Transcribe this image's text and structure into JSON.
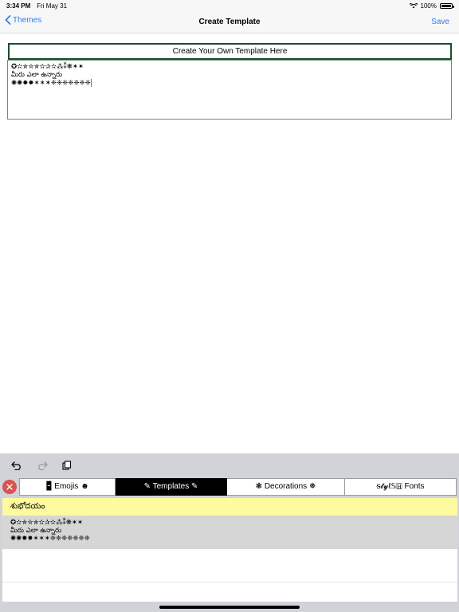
{
  "status": {
    "time": "3:34 PM",
    "date": "Fri May 31",
    "battery": "100%",
    "battery_level": 1.0
  },
  "nav": {
    "back_label": "Themes",
    "title": "Create Template",
    "save_label": "Save"
  },
  "editor": {
    "header": "Create Your Own Template Here",
    "lines": [
      "✪✫✯✮✯✫✰✫⁂⁑❋✶✶",
      "మీరు ఎలా ఉన్నారు",
      "✺✺✹✸✶✶✶❈❈❈❈❈❈❈"
    ]
  },
  "toolbar": {
    "icons": [
      "undo-icon",
      "redo-icon",
      "paste-icon"
    ]
  },
  "tabs": [
    {
      "label": "🁢 Emojis ☻",
      "active": false
    },
    {
      "label": "✎ Templates ✎",
      "active": true
    },
    {
      "label": "❃ Decorations ❅",
      "active": false
    },
    {
      "label": "ᵴ𝓽𝔂ℓ𝕊🄷   Fonts",
      "active": false
    }
  ],
  "templates": {
    "highlight_item": "శుభోదయం",
    "selected_item": [
      "✪✫✯✮✯✫✰✫⁂⁑❋✶✶",
      "మీరు ఎలా ఉన్నారు",
      "✺✺✹✸✶✶✶❈❈❈❈❈❈❈"
    ]
  },
  "colors": {
    "accent": "#2f7cf6",
    "close_red": "#d9534f",
    "highlight_yellow": "#fdfaa0",
    "editor_border": "#1c4d2e"
  }
}
